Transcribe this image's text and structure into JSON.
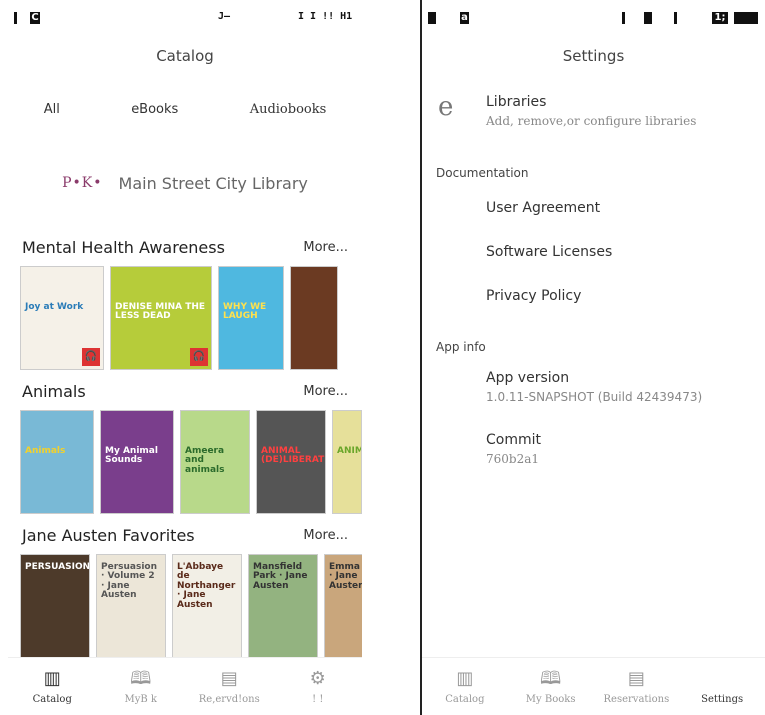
{
  "left": {
    "status": {
      "left": "C",
      "middle": "J–",
      "right": "I I !! H1"
    },
    "title": "Catalog",
    "tabs": [
      {
        "label": "All"
      },
      {
        "label": "eBooks"
      },
      {
        "label": "Audiobooks"
      }
    ],
    "library": {
      "logo": "P•K•",
      "name": "Main Street City Library"
    },
    "lanes": [
      {
        "title": "Mental Health Awareness",
        "more": "More...",
        "covers": [
          {
            "text": "Joy at Work",
            "bg": "#f5f1e8",
            "fg": "#2a7cb8",
            "audio": true
          },
          {
            "text": "DENISE MINA THE LESS DEAD",
            "bg": "#b6cc3a",
            "fg": "#ffffff",
            "audio": true
          },
          {
            "text": "WHY WE LAUGH",
            "bg": "#4fb8e0",
            "fg": "#ffe14d",
            "audio": false
          },
          {
            "text": "",
            "bg": "#6b3a22",
            "fg": "#ffffff",
            "audio": false
          }
        ]
      },
      {
        "title": "Animals",
        "more": "More...",
        "covers": [
          {
            "text": "Animals",
            "bg": "#79b9d6",
            "fg": "#f3d12b",
            "audio": false
          },
          {
            "text": "My Animal Sounds",
            "bg": "#7a3e8c",
            "fg": "#ffffff",
            "audio": false
          },
          {
            "text": "Ameera and animals",
            "bg": "#b8d98a",
            "fg": "#2b6b2b",
            "audio": false
          },
          {
            "text": "ANIMAL (DE)LIBERATION",
            "bg": "#555555",
            "fg": "#ff4040",
            "audio": false
          },
          {
            "text": "ANIM",
            "bg": "#e6e09a",
            "fg": "#6aa62a",
            "audio": false
          }
        ]
      },
      {
        "title": "Jane Austen Favorites",
        "more": "More...",
        "covers": [
          {
            "text": "PERSUASION",
            "bg": "#4d3a2a",
            "fg": "#ffffff",
            "audio": false
          },
          {
            "text": "Persuasion · Volume 2 · Jane Austen",
            "bg": "#ece6d8",
            "fg": "#555555",
            "audio": false
          },
          {
            "text": "L'Abbaye de Northanger · Jane Austen",
            "bg": "#f2efe6",
            "fg": "#5a2a1a",
            "audio": false
          },
          {
            "text": "Mansfield Park · Jane Austen",
            "bg": "#93b380",
            "fg": "#333333",
            "audio": false
          },
          {
            "text": "Emma · Jane Austen",
            "bg": "#c9a67c",
            "fg": "#333333",
            "audio": false
          }
        ]
      }
    ],
    "nav": [
      {
        "label": "Catalog",
        "icon": "▥",
        "active": true
      },
      {
        "label": "MyB  k",
        "icon": "🕮",
        "active": false
      },
      {
        "label": "Re,ervd!ons",
        "icon": "▤",
        "active": false
      },
      {
        "label": "! !",
        "icon": "⚙",
        "active": false
      }
    ]
  },
  "right": {
    "status": {
      "left": "a",
      "right": "1;"
    },
    "title": "Settings",
    "libraries": {
      "icon": "e",
      "title": "Libraries",
      "subtitle": "Add, remove,or configure libraries"
    },
    "documentation_header": "Documentation",
    "documentation_items": [
      {
        "label": "User Agreement"
      },
      {
        "label": "Software Licenses"
      },
      {
        "label": "Privacy Policy"
      }
    ],
    "appinfo_header": "App info",
    "app_version": {
      "title": "App version",
      "value": "1.0.11-SNAPSHOT (Build 42439473)"
    },
    "commit": {
      "title": "Commit",
      "value": "760b2a1"
    },
    "nav": [
      {
        "label": "Catalog",
        "icon": "▥",
        "active": false
      },
      {
        "label": "My Books",
        "icon": "🕮",
        "active": false
      },
      {
        "label": "Reservations",
        "icon": "▤",
        "active": false
      },
      {
        "label": "Settings",
        "icon": "",
        "active": true
      }
    ]
  }
}
